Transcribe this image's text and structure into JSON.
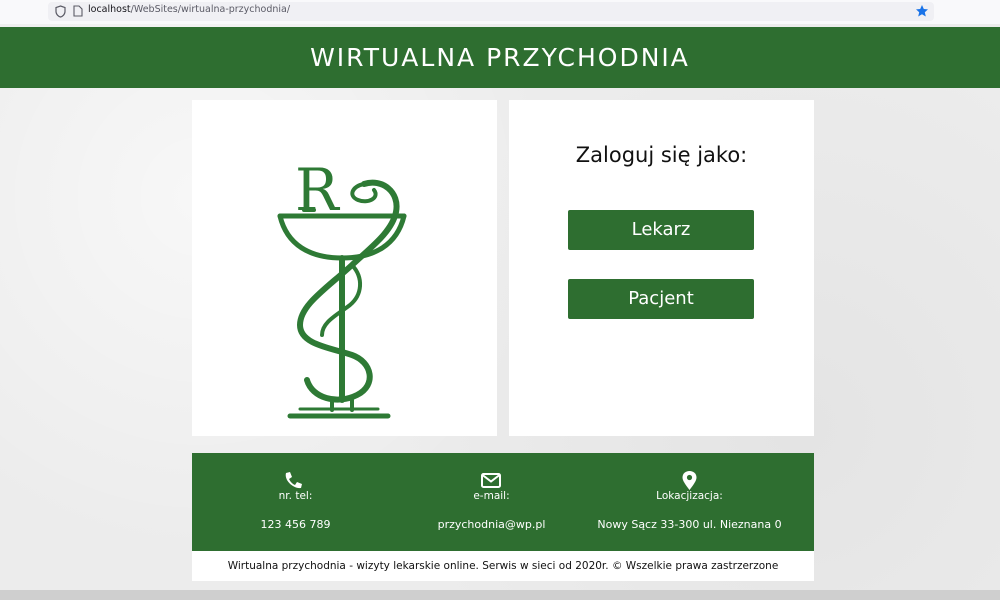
{
  "browser": {
    "url_host": "localhost",
    "url_path": "/WebSites/wirtualna-przychodnia/"
  },
  "header": {
    "title": "WIRTUALNA PRZYCHODNIA"
  },
  "login": {
    "title": "Zaloguj się jako:",
    "buttons": [
      {
        "label": "Lekarz"
      },
      {
        "label": "Pacjent"
      }
    ]
  },
  "logo": {
    "text": "R"
  },
  "footer": {
    "items": [
      {
        "icon": "phone-icon",
        "label": "nr. tel:",
        "value": "123 456 789"
      },
      {
        "icon": "envelope-icon",
        "label": "e-mail:",
        "value": "przychodnia@wp.pl"
      },
      {
        "icon": "map-pin-icon",
        "label": "Lokacjizacja:",
        "value": "Nowy Sącz 33-300 ul. Nieznana 0"
      }
    ],
    "copyright": "Wirtualna przychodnia - wizyty lekarskie online. Serwis w sieci od 2020r. © Wszelkie prawa zastrzerzone"
  },
  "colors": {
    "brand_green": "#2e6e30",
    "star_blue": "#1a73e8"
  }
}
